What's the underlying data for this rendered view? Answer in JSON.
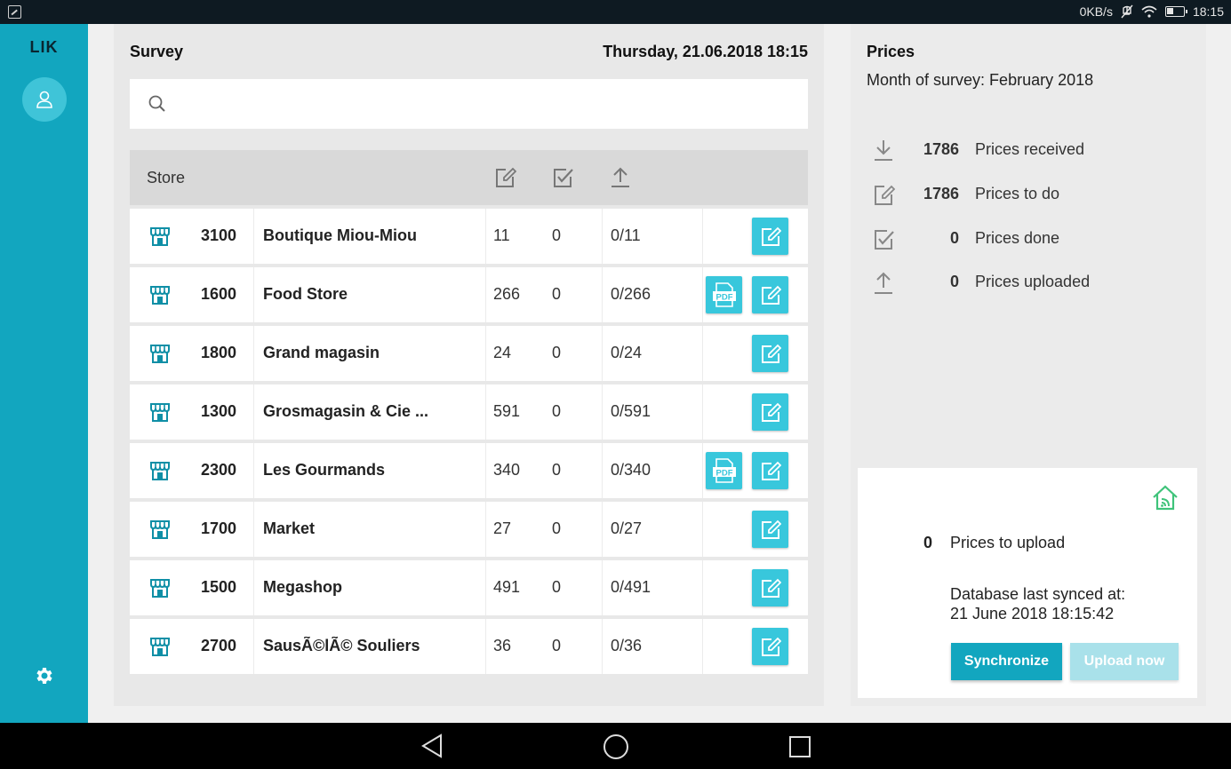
{
  "statusbar": {
    "speed": "0KB/s",
    "time": "18:15"
  },
  "sidebar": {
    "brand": "LIK"
  },
  "survey": {
    "title": "Survey",
    "date": "Thursday, 21.06.2018 18:15",
    "search_placeholder": "",
    "header": {
      "store": "Store"
    },
    "rows": [
      {
        "num": "3100",
        "name": "Boutique Miou-Miou",
        "c1": "11",
        "c2": "0",
        "c3": "0/11",
        "pdf": false
      },
      {
        "num": "1600",
        "name": "Food Store",
        "c1": "266",
        "c2": "0",
        "c3": "0/266",
        "pdf": true
      },
      {
        "num": "1800",
        "name": "Grand magasin",
        "c1": "24",
        "c2": "0",
        "c3": "0/24",
        "pdf": false
      },
      {
        "num": "1300",
        "name": "Grosmagasin & Cie ...",
        "c1": "591",
        "c2": "0",
        "c3": "0/591",
        "pdf": false
      },
      {
        "num": "2300",
        "name": "Les Gourmands",
        "c1": "340",
        "c2": "0",
        "c3": "0/340",
        "pdf": true
      },
      {
        "num": "1700",
        "name": "Market",
        "c1": "27",
        "c2": "0",
        "c3": "0/27",
        "pdf": false
      },
      {
        "num": "1500",
        "name": "Megashop",
        "c1": "491",
        "c2": "0",
        "c3": "0/491",
        "pdf": false
      },
      {
        "num": "2700",
        "name": "SausÃ©lÃ© Souliers",
        "c1": "36",
        "c2": "0",
        "c3": "0/36",
        "pdf": false
      }
    ]
  },
  "prices": {
    "title": "Prices",
    "month": "Month of survey: February 2018",
    "stats": [
      {
        "num": "1786",
        "label": "Prices received",
        "icon": "download-icon"
      },
      {
        "num": "1786",
        "label": "Prices to do",
        "icon": "edit-icon"
      },
      {
        "num": "0",
        "label": "Prices done",
        "icon": "checkbox-icon"
      },
      {
        "num": "0",
        "label": "Prices uploaded",
        "icon": "upload-icon"
      }
    ],
    "sync": {
      "to_upload_num": "0",
      "to_upload_label": "Prices to upload",
      "db_line1": "Database last synced at:",
      "db_line2": "21 June 2018 18:15:42",
      "sync_label": "Synchronize",
      "upload_label": "Upload now"
    }
  },
  "colors": {
    "accent": "#12a6bf",
    "button": "#38c7dc",
    "home_online": "#3fc37a"
  }
}
